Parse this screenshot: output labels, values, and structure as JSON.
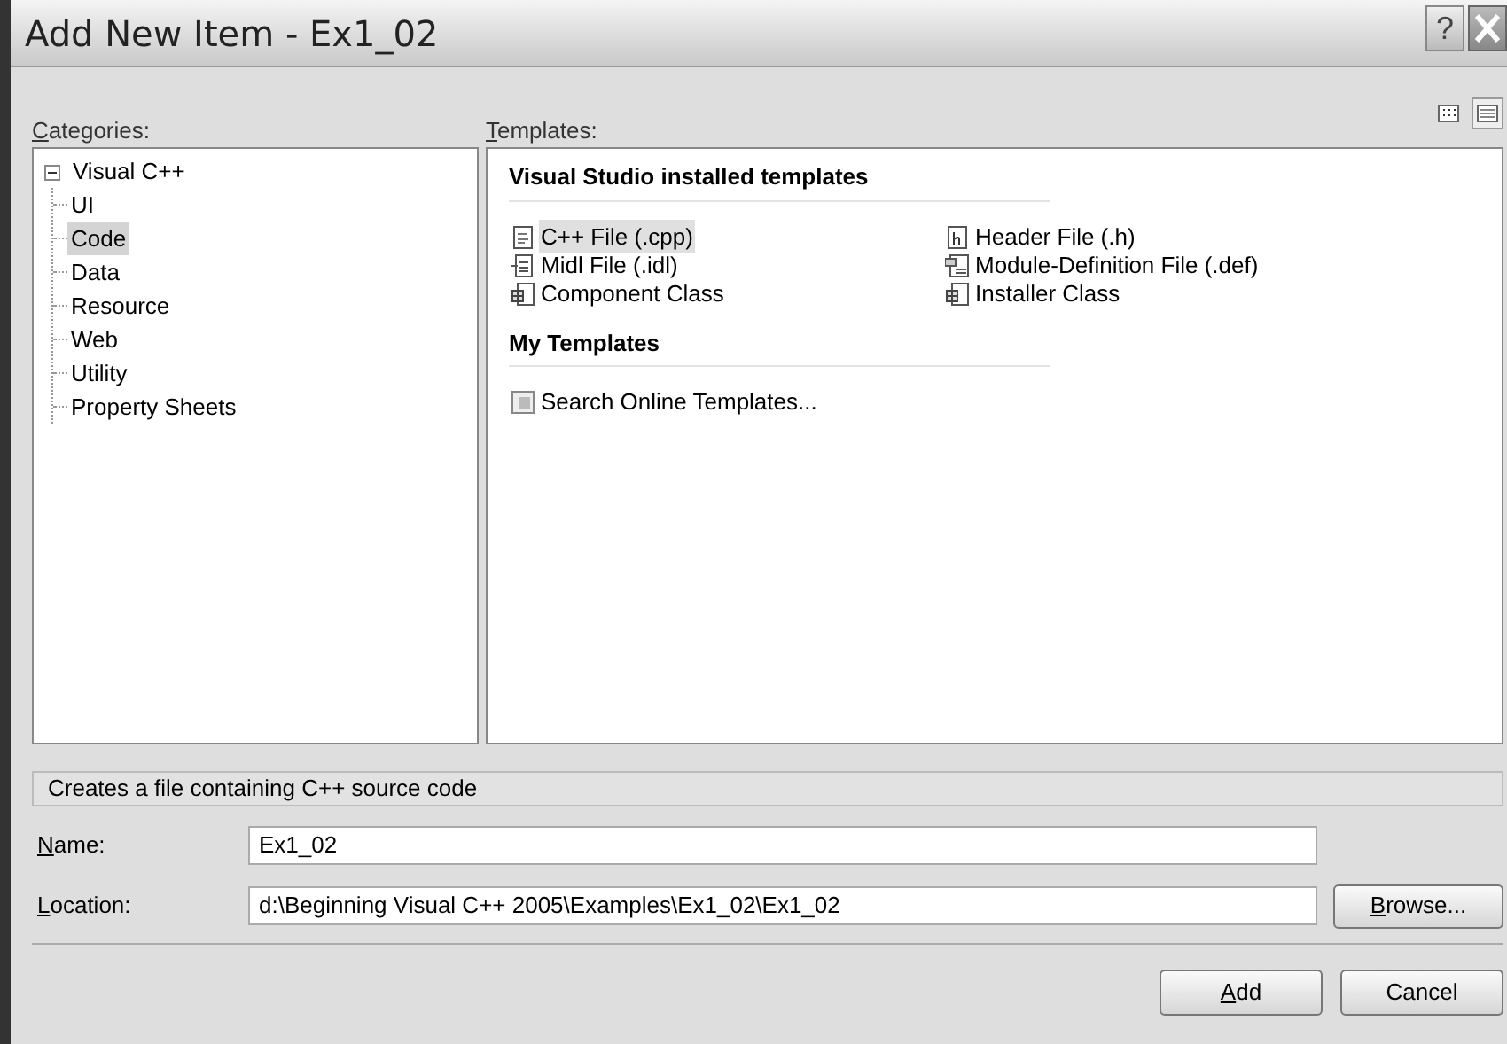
{
  "window": {
    "title": "Add New Item - Ex1_02",
    "buttons": [
      {
        "kind": "help",
        "label": "?"
      },
      {
        "kind": "close"
      }
    ]
  },
  "categories": {
    "label": "Categories:",
    "underline_first": true,
    "tree": [
      {
        "label": "Visual C++",
        "expanded": true,
        "selected": false,
        "children": [
          {
            "label": "UI",
            "selected": false
          },
          {
            "label": "Code",
            "selected": true
          },
          {
            "label": "Data",
            "selected": false
          },
          {
            "label": "Resource",
            "selected": false
          },
          {
            "label": "Web",
            "selected": false
          },
          {
            "label": "Utility",
            "selected": false
          },
          {
            "label": "Property Sheets",
            "selected": false
          }
        ]
      }
    ]
  },
  "templates": {
    "label": "Templates:",
    "underline_first": true,
    "view_buttons": [
      {
        "kind": "large-icons",
        "selected": false
      },
      {
        "kind": "small-icons",
        "selected": true
      }
    ],
    "sections": [
      {
        "heading": "Visual Studio installed templates",
        "items": [
          {
            "label": "C++ File (.cpp)",
            "kind": "cpp",
            "selected": true
          },
          {
            "label": "Header File (.h)",
            "kind": "header",
            "selected": false
          },
          {
            "label": "Midl File (.idl)",
            "kind": "midl",
            "selected": false
          },
          {
            "label": "Module-Definition File (.def)",
            "kind": "def",
            "selected": false
          },
          {
            "label": "Component Class",
            "kind": "class",
            "selected": false
          },
          {
            "label": "Installer Class",
            "kind": "class",
            "selected": false
          }
        ]
      },
      {
        "heading": "My Templates",
        "items": [
          {
            "label": "Search Online Templates...",
            "kind": "search",
            "selected": false
          }
        ]
      }
    ]
  },
  "description": "Creates a file containing C++ source code",
  "fields": [
    {
      "label": "Name:",
      "underline_first": true,
      "value": "Ex1_02"
    },
    {
      "label": "Location:",
      "underline_first": true,
      "value": "d:\\Beginning Visual C++ 2005\\Examples\\Ex1_02\\Ex1_02",
      "button": "Browse..."
    }
  ],
  "buttons": [
    {
      "label": "Add",
      "underline_first": true
    },
    {
      "label": "Cancel",
      "underline_first": false
    }
  ]
}
